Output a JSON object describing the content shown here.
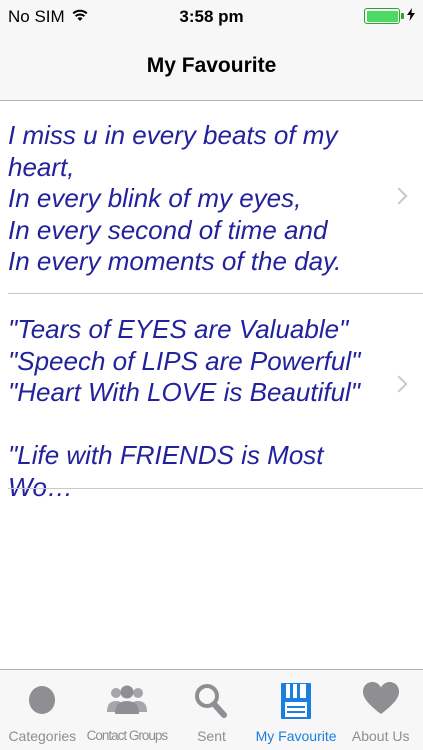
{
  "status_bar": {
    "carrier": "No SIM",
    "time": "3:58 pm"
  },
  "nav": {
    "title": "My Favourite"
  },
  "favourites": [
    {
      "text": "I miss u in every beats of my\nheart,\nIn every blink of my eyes,\nIn every second of time and\nIn every moments of the day."
    },
    {
      "text": "\"Tears of EYES are Valuable\"\n\"Speech of LIPS are Powerful\"\n\"Heart With LOVE is Beautiful\"\n\n\"Life with FRIENDS is Most Wo…"
    }
  ],
  "tabs": [
    {
      "label": "Categories",
      "icon": "circle-icon"
    },
    {
      "label": "Contact Groups",
      "icon": "people-icon"
    },
    {
      "label": "Sent",
      "icon": "search-icon"
    },
    {
      "label": "My Favourite",
      "icon": "floppy-disk-icon",
      "active": true
    },
    {
      "label": "About Us",
      "icon": "heart-icon"
    }
  ],
  "colors": {
    "quote_text": "#22229c",
    "tab_active": "#1a7fe0",
    "tab_inactive": "#8e8e93",
    "battery": "#4cd964"
  }
}
